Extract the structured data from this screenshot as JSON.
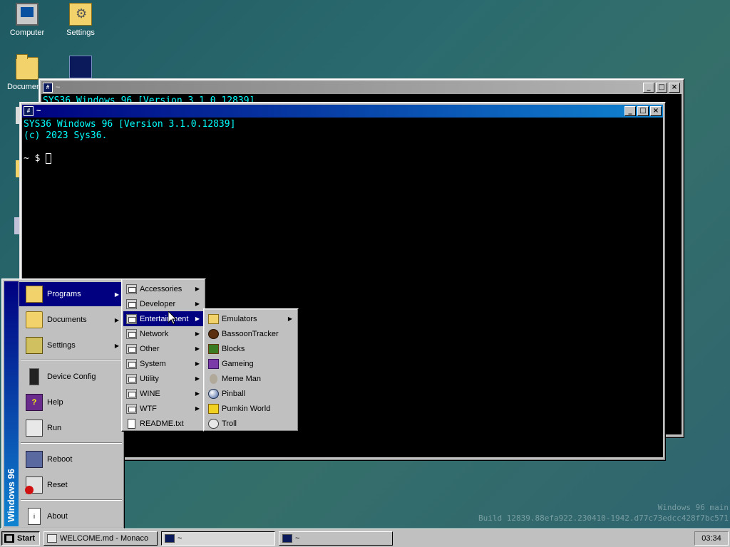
{
  "desktop": {
    "icons": [
      {
        "label": "Computer"
      },
      {
        "label": "Settings"
      },
      {
        "label": "Documents"
      },
      {
        "label": ""
      }
    ],
    "watermark": {
      "line1": "Windows 96 main",
      "line2": "Build 12839.88efa922.230410-1942.d77c73edcc428f7bc571"
    }
  },
  "windows": {
    "back": {
      "title": "~",
      "peek_text": "SYS36 Windows 96 [Version 3.1.0.12839]"
    },
    "front": {
      "title": "~",
      "lines": [
        "SYS36 Windows 96 [Version 3.1.0.12839]",
        "(c) 2023 Sys36."
      ],
      "prompt": "~ $ "
    },
    "controls": {
      "minimize": "_",
      "maximize": "□",
      "close": "×"
    }
  },
  "start_menu": {
    "banner": "Windows 96",
    "items": [
      {
        "label": "Programs",
        "icon": "programs-icon",
        "has_sub": true
      },
      {
        "label": "Documents",
        "icon": "documents-icon",
        "has_sub": true
      },
      {
        "label": "Settings",
        "icon": "settings-icon",
        "has_sub": true
      },
      {
        "label": "Device Config",
        "icon": "device-icon",
        "has_sub": false
      },
      {
        "label": "Help",
        "icon": "help-icon",
        "has_sub": false
      },
      {
        "label": "Run",
        "icon": "run-icon",
        "has_sub": false
      },
      {
        "label": "Reboot",
        "icon": "reboot-icon",
        "has_sub": false
      },
      {
        "label": "Reset",
        "icon": "reset-icon",
        "has_sub": false
      },
      {
        "label": "About",
        "icon": "about-icon",
        "has_sub": false
      }
    ],
    "programs": [
      {
        "label": "Accessories"
      },
      {
        "label": "Developer"
      },
      {
        "label": "Entertainment"
      },
      {
        "label": "Network"
      },
      {
        "label": "Other"
      },
      {
        "label": "System"
      },
      {
        "label": "Utility"
      },
      {
        "label": "WINE"
      },
      {
        "label": "WTF"
      },
      {
        "label": "README.txt"
      }
    ],
    "entertainment": [
      {
        "label": "Emulators"
      },
      {
        "label": "BassoonTracker"
      },
      {
        "label": "Blocks"
      },
      {
        "label": "Gameing"
      },
      {
        "label": "Meme Man"
      },
      {
        "label": "Pinball"
      },
      {
        "label": "Pumkin World"
      },
      {
        "label": "Troll"
      }
    ],
    "arrow": "▶"
  },
  "taskbar": {
    "start_label": "Start",
    "tasks": [
      {
        "label": "WELCOME.md - Monaco"
      },
      {
        "label": "~"
      },
      {
        "label": "~"
      }
    ],
    "clock": "03:34"
  },
  "colors": {
    "title_active": "#000080",
    "terminal_text": "#00ffff",
    "terminal_bg": "#000000",
    "desktop": "#2a6a6e"
  }
}
